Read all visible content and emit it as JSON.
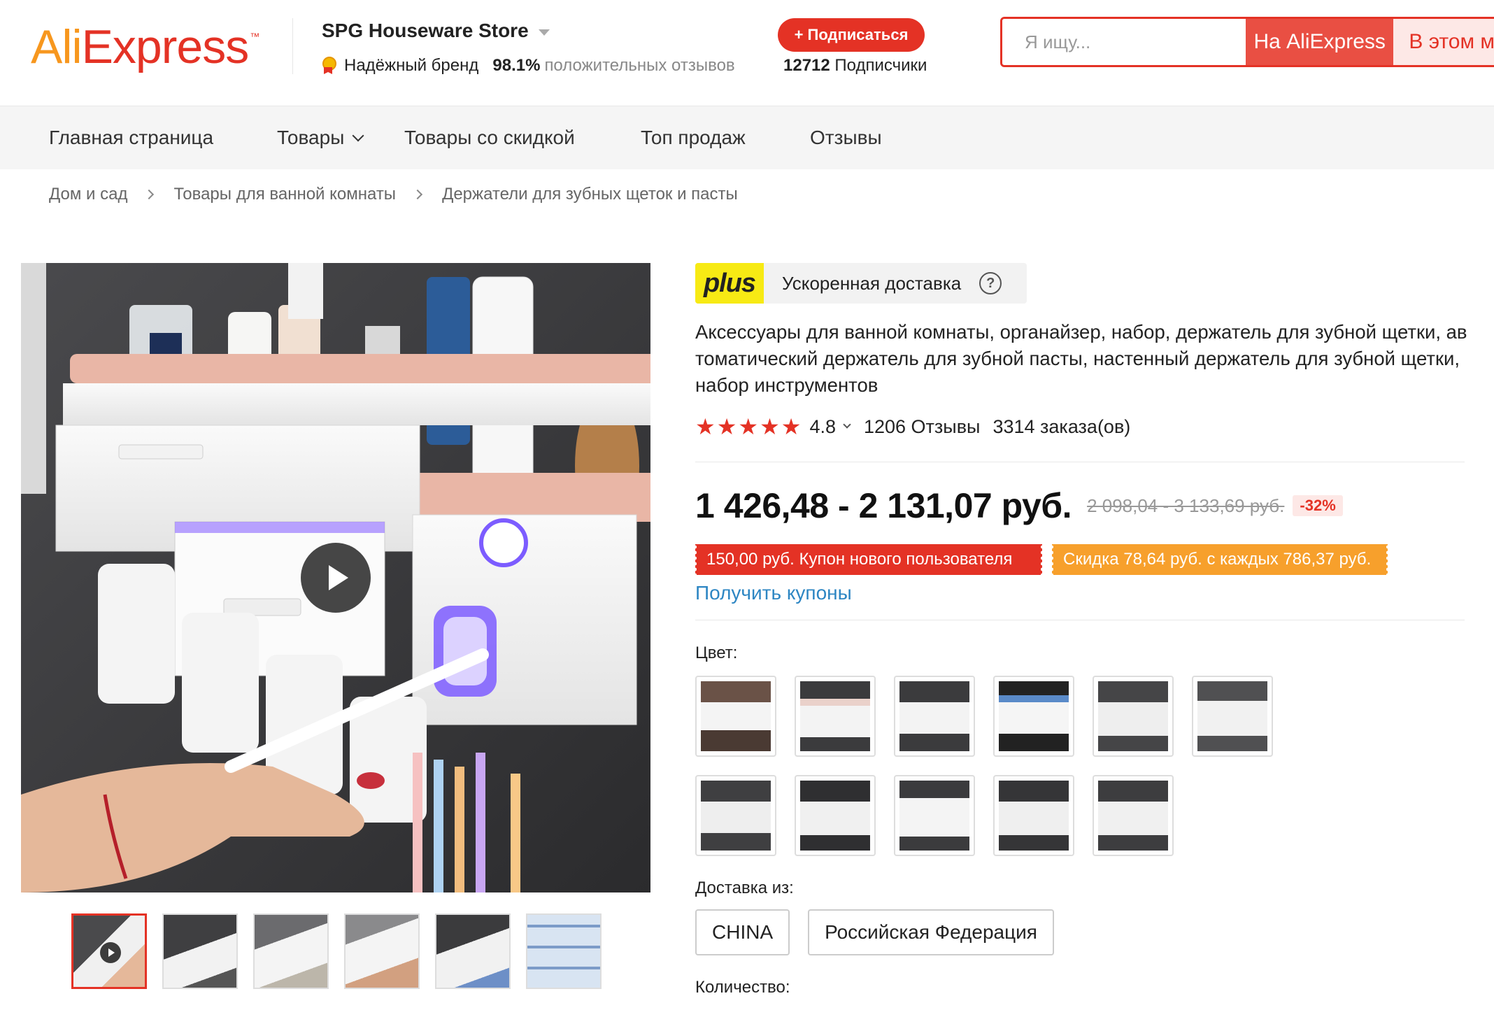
{
  "header": {
    "logo_text": "AliExpress",
    "logo_part1": "Ali",
    "logo_part2": "Express",
    "logo_tm": "™",
    "store_name": "SPG Houseware Store",
    "badge_label": "Надёжный бренд",
    "positive_percent": "98.1%",
    "positive_label": "положительных отзывов",
    "subscribe_label": "+ Подписаться",
    "followers_count": "12712",
    "followers_label": "Подписчики",
    "search_placeholder": "Я ищу...",
    "search_btn_ali": "На AliExpress",
    "search_btn_store": "В этом м"
  },
  "nav": {
    "items": [
      "Главная страница",
      "Товары",
      "Товары со скидкой",
      "Топ продаж",
      "Отзывы"
    ]
  },
  "breadcrumb": [
    "Дом и сад",
    "Товары для ванной комнаты",
    "Держатели для зубных щеток и пасты"
  ],
  "product": {
    "plus_badge": "plus",
    "plus_text": "Ускоренная доставка",
    "help_glyph": "?",
    "title": "Аксессуары для ванной комнаты, органайзер, набор, держатель для зубной щетки, автоматический держатель для зубной пасты, настенный держатель для зубной щетки, набор инструментов",
    "rating": {
      "stars": 5,
      "score": "4.8",
      "reviews": "1206 Отзывы",
      "orders": "3314 заказа(ов)"
    },
    "price": "1 426,48 - 2 131,07 руб.",
    "old_price": "2 098,04 - 3 133,69 руб.",
    "discount": "-32%",
    "coupon_new_user": "150,00 руб. Купон нового пользователя",
    "coupon_discount": "Скидка 78,64 руб. с каждых 786,37 руб.",
    "get_coupons": "Получить купоны",
    "color_label": "Цвет:",
    "color_swatch_count": 11,
    "ship_from_label": "Доставка из:",
    "ship_options": [
      "CHINA",
      "Российская Федерация"
    ],
    "quantity_label": "Количество:"
  },
  "icons": {
    "brand_badge": "medal-icon",
    "nav_products": "chevron-down-icon",
    "breadcrumb_sep": "chevron-right-icon",
    "video": "play-icon",
    "help": "question-circle-icon",
    "rating_star": "star-icon"
  },
  "colors": {
    "brand_red": "#e43225",
    "brand_orange": "#f7971e",
    "coupon_orange": "#f7a02c",
    "link_blue": "#2d86c3",
    "plus_yellow": "#f7ea14"
  }
}
